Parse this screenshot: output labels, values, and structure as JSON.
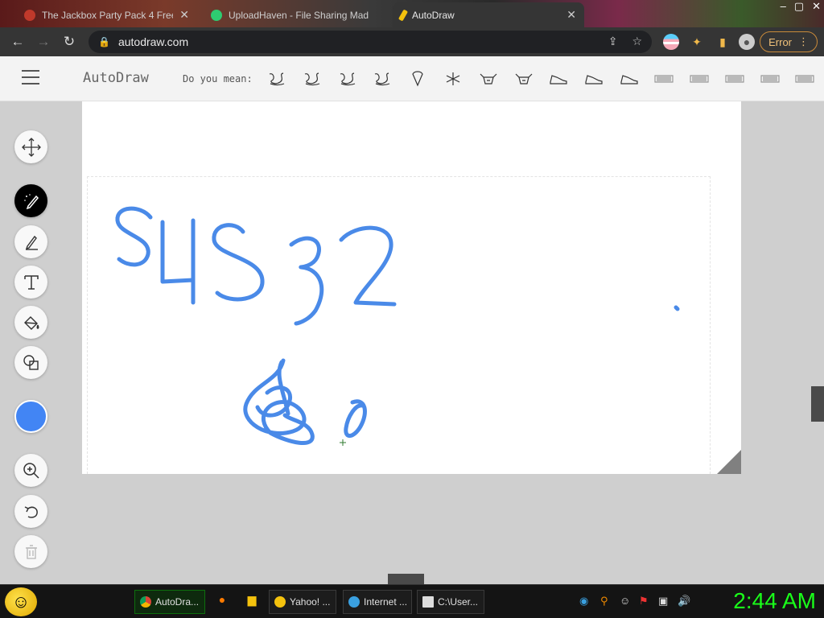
{
  "browser": {
    "tabs": [
      {
        "title": "The Jackbox Party Pack 4 Free C",
        "active": false
      },
      {
        "title": "UploadHaven - File Sharing Mad",
        "active": false
      },
      {
        "title": "AutoDraw",
        "active": true
      }
    ],
    "url": "autodraw.com",
    "error_label": "Error",
    "new_tab": "+"
  },
  "autodraw": {
    "title": "AutoDraw",
    "do_you_mean": "Do you mean:",
    "suggestions": [
      "scribble-1",
      "maze-1",
      "scribble-2",
      "dragon",
      "ice-cream",
      "snowflake",
      "bull",
      "ox",
      "sneaker-1",
      "boot",
      "sneaker-2",
      "keyboard-1",
      "keyboard-2",
      "keyboard-3",
      "keyboard-4",
      "keyboard-5"
    ],
    "tools": [
      "select-move",
      "autodraw",
      "draw",
      "type",
      "fill",
      "shape",
      "color",
      "zoom",
      "undo",
      "delete"
    ],
    "pen_color": "#4285f4",
    "drawing_text": "SUS32"
  },
  "taskbar": {
    "tasks": [
      {
        "label": "AutoDra...",
        "active": true
      },
      {
        "label": "Yahoo! ...",
        "active": false
      },
      {
        "label": "Internet ...",
        "active": false
      },
      {
        "label": "C:\\User...",
        "active": false
      }
    ],
    "clock": "2:44 AM"
  }
}
